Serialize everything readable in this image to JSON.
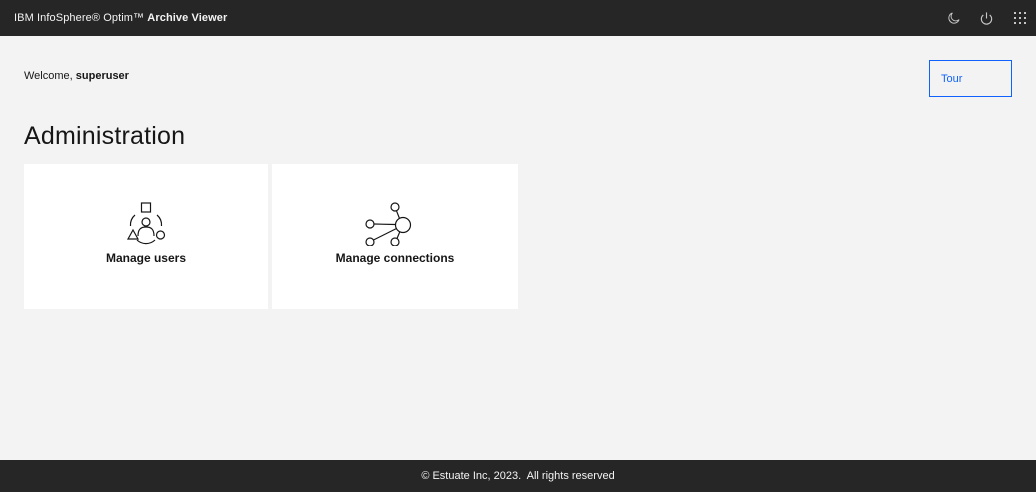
{
  "header": {
    "brand_prefix": "IBM InfoSphere® Optim™",
    "brand_product": "Archive Viewer",
    "actions": [
      {
        "icon": "moon-icon",
        "label": "Theme"
      },
      {
        "icon": "power-icon",
        "label": "Log out"
      },
      {
        "icon": "app-switcher-icon",
        "label": "Apps"
      }
    ]
  },
  "welcome": {
    "prefix": "Welcome,",
    "username": "superuser"
  },
  "tour_button": {
    "label": "Tour"
  },
  "page_title": "Administration",
  "tiles": [
    {
      "label": "Manage users",
      "icon": "users-group-icon"
    },
    {
      "label": "Manage connections",
      "icon": "connections-network-icon"
    }
  ],
  "footer": {
    "copyright": "© Estuate Inc, 2023.  All rights reserved"
  }
}
